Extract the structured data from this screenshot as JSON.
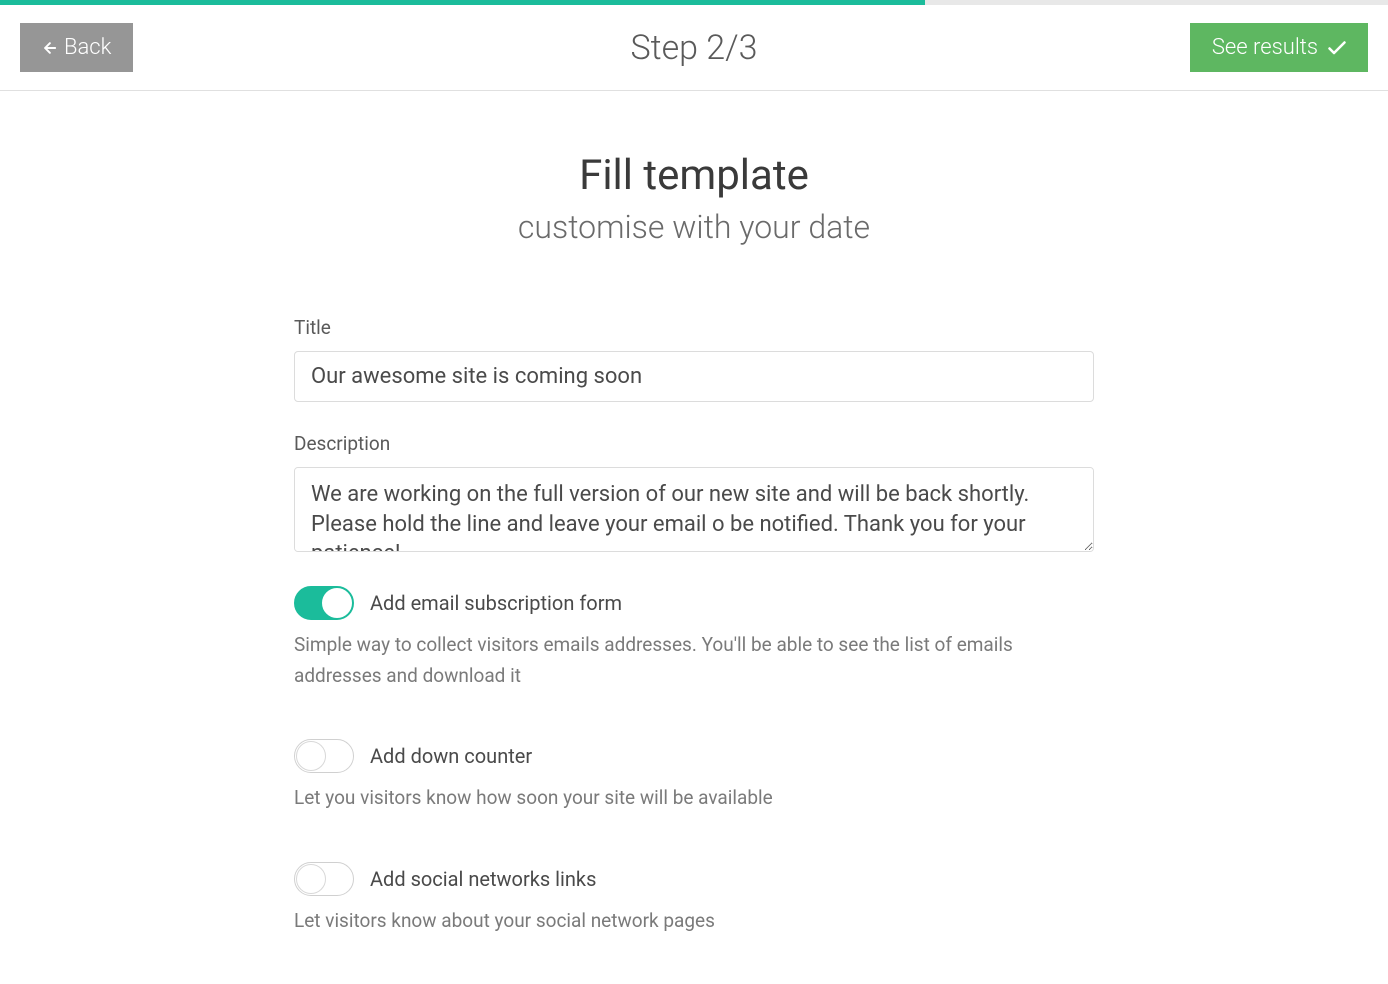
{
  "header": {
    "back_label": "Back",
    "step_label": "Step 2/3",
    "results_label": "See results"
  },
  "page": {
    "heading": "Fill template",
    "subheading": "customise with your date"
  },
  "form": {
    "title_label": "Title",
    "title_value": "Our awesome site is coming soon",
    "description_label": "Description",
    "description_value": "We are working on the full version of our new site and will be back shortly. Please hold the line and leave your email o be notified. Thank you for your patience!"
  },
  "toggles": {
    "email": {
      "label": "Add email subscription form",
      "description": "Simple way to collect visitors emails addresses. You'll be able to see the list of emails addresses and download it",
      "on": true
    },
    "counter": {
      "label": "Add down counter",
      "description": "Let you visitors know how soon your site will be available",
      "on": false
    },
    "social": {
      "label": "Add social networks links",
      "description": "Let visitors know about your social network pages",
      "on": false
    }
  }
}
